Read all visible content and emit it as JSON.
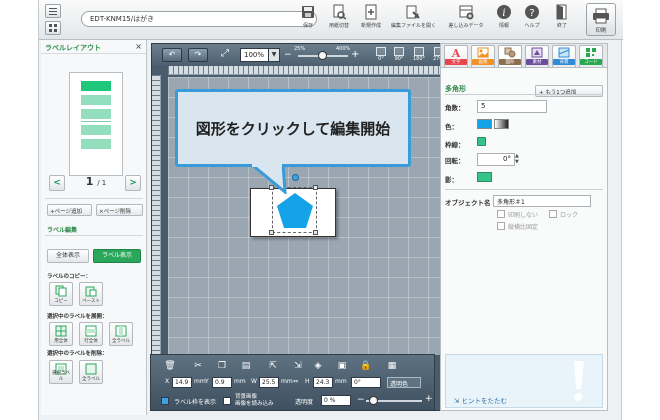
{
  "toolbar": {
    "doc_name": "EDT-KNM15/はがき",
    "tools": [
      {
        "label": "保存",
        "icon": "save-icon"
      },
      {
        "label": "用紙切替",
        "icon": "paper-switch-icon"
      },
      {
        "label": "新規作成",
        "icon": "new-document-icon"
      },
      {
        "label": "編集ファイルを開く",
        "icon": "open-file-icon"
      },
      {
        "label": "差し込みデータ",
        "icon": "merge-data-icon"
      },
      {
        "label": "情報",
        "icon": "info-icon"
      },
      {
        "label": "ヘルプ",
        "icon": "help-icon"
      },
      {
        "label": "終了",
        "icon": "exit-icon"
      }
    ],
    "print_label": "印刷"
  },
  "left": {
    "title": "ラベルレイアウト",
    "close": "×",
    "page_current": "1",
    "page_total": "/ 1",
    "prev": "<",
    "next": ">",
    "add_page": "+ページ追加",
    "delete_page": "×ページ削除",
    "label_edit": "ラベル編集",
    "show_all": "全体表示",
    "show_label": "ラベル表示",
    "copy_section": "ラベルのコピー：",
    "copy": "コピー",
    "paste": "ペースト",
    "expand_section": "選択中のラベルを展開：",
    "expand_all": "用全体",
    "expand_row": "行全体",
    "expand_col": "全ラベル",
    "delete_section": "選択中のラベルを削除：",
    "delete_selected": "選択ラベル",
    "delete_all": "全ラベル"
  },
  "canvas": {
    "zoom": "100%",
    "zoom_min": "25%",
    "zoom_max": "400%",
    "zoom_minus": "−",
    "zoom_plus": "+",
    "fit_icon": "fit-screen-icon",
    "views": [
      "0°",
      "90°",
      "180°",
      "270°"
    ],
    "callout": "図形をクリックして編集開始",
    "shape_color": "#14a3e8"
  },
  "bottom": {
    "x_label": "X",
    "x": "14.9",
    "y_label": "Y",
    "y": "0.9",
    "w_label": "W",
    "w": "25.5",
    "h_label": "H",
    "h": "24.3",
    "unit": "mm",
    "angle": "0°",
    "transparent_label": "透明色",
    "show_frame": "ラベル枠を表示",
    "bg_image": "画像を読み込み",
    "bg_label": "背景画像",
    "opacity_label": "透明度",
    "opacity": "0 %"
  },
  "right": {
    "tabs": [
      {
        "label": "文字",
        "color": "#e8464d",
        "icon": "text-icon"
      },
      {
        "label": "画像",
        "color": "#f29124",
        "icon": "image-icon"
      },
      {
        "label": "図形",
        "color": "#8d6e4f",
        "icon": "shape-icon"
      },
      {
        "label": "素材",
        "color": "#6b4f9e",
        "icon": "material-icon"
      },
      {
        "label": "背景",
        "color": "#2f8bd6",
        "icon": "background-icon"
      },
      {
        "label": "コード",
        "color": "#27a84f",
        "icon": "code-icon"
      }
    ],
    "title": "多角形",
    "add_another": "+ もう1つ追加",
    "corners_label": "角数：",
    "corners": "5",
    "color_label": "色：",
    "border_label": "枠線：",
    "rotate_label": "回転：",
    "rotate": "0°",
    "shadow_label": "影：",
    "object_name_label": "オブジェクト名",
    "object_name": "多角形＃1",
    "no_print": "印刷しない",
    "lock": "ロック",
    "fix_aspect": "縦横比固定",
    "hint_toggle": "ヒントをたたむ",
    "fill_color": "#14a3e8",
    "shadow_color": "#36c48b"
  }
}
